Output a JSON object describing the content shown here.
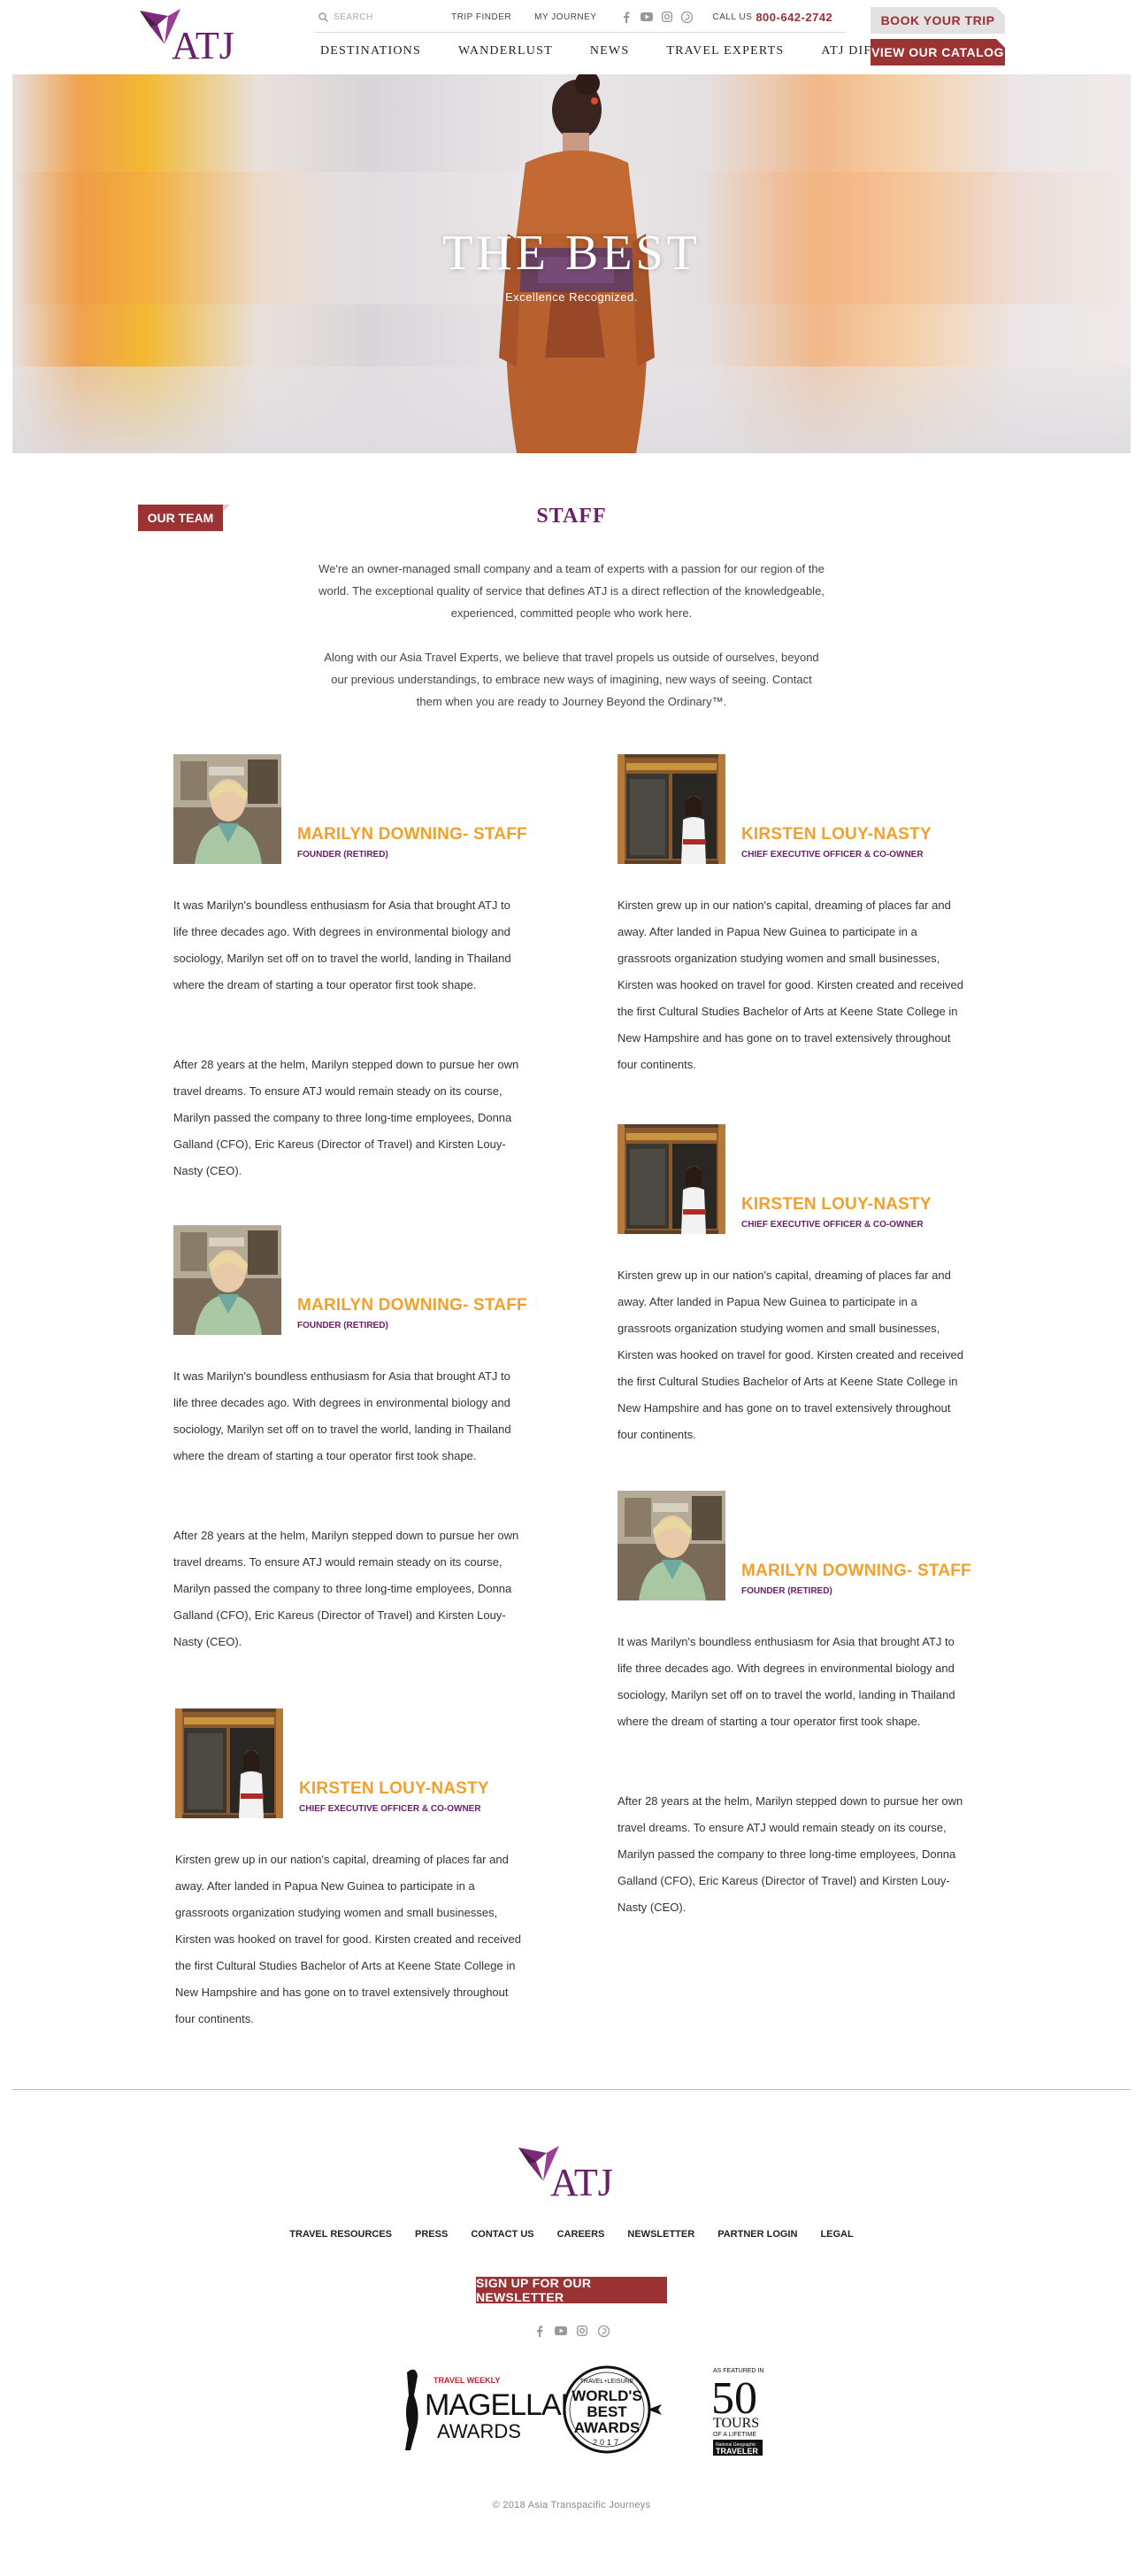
{
  "header": {
    "logo_text": "ATJ",
    "search_placeholder": "SEARCH",
    "util_links": [
      "TRIP FINDER",
      "MY JOURNEY"
    ],
    "social_icons": [
      "facebook-icon",
      "youtube-icon",
      "instagram-icon",
      "pinterest-icon"
    ],
    "call_label": "CALL US",
    "phone": "800-642-2742",
    "nav": [
      "DESTINATIONS",
      "WANDERLUST",
      "NEWS",
      "TRAVEL EXPERTS",
      "ATJ DIFFERENCE"
    ],
    "book_label": "BOOK YOUR TRIP",
    "catalog_label": "VIEW OUR CATALOG"
  },
  "hero": {
    "title": "THE BEST",
    "subtitle": "Excellence Recognized."
  },
  "intro": {
    "tag": "OUR TEAM",
    "title": "STAFF",
    "para1": "We're an owner-managed small company and a team of experts with a passion for our region of the world. The exceptional quality of service that defines ATJ is a direct reflection of the knowledgeable, experienced, committed people who work here.",
    "para2": "Along with our Asia Travel Experts, we believe that travel propels us outside of ourselves, beyond our previous understandings, to embrace new ways of imagining, new ways of seeing. Contact them when you are ready to Journey Beyond the Ordinary™."
  },
  "profiles": [
    {
      "name": "MARILYN DOWNING- STAFF",
      "role": "FOUNDER (RETIRED)",
      "photo": "marilyn",
      "bio1": "It was Marilyn's boundless enthusiasm for Asia that brought ATJ to life three decades ago. With degrees in environmental biology and sociology, Marilyn set off on to travel the world, landing in Thailand where the dream of starting a tour operator first took shape.",
      "bio2": "After 28 years at the helm, Marilyn stepped down to pursue her own travel dreams. To ensure ATJ would remain steady on its course, Marilyn passed the company to three long-time employees, Donna Galland (CFO), Eric Kareus (Director of Travel) and Kirsten Louy-Nasty (CEO)."
    },
    {
      "name": "KIRSTEN LOUY-NASTY",
      "role": "CHIEF EXECUTIVE OFFICER & CO-OWNER",
      "photo": "kirsten",
      "bio1": "Kirsten grew up in our nation's capital, dreaming of places far and away. After landed in Papua New Guinea to participate in a grassroots organization studying women and small businesses, Kirsten was hooked on travel for good. Kirsten created and received the first Cultural Studies Bachelor of Arts at Keene State College in New Hampshire and has gone on to travel extensively throughout four continents.",
      "bio2": ""
    },
    {
      "name": "KIRSTEN LOUY-NASTY",
      "role": "CHIEF EXECUTIVE OFFICER & CO-OWNER",
      "photo": "kirsten",
      "bio1": "Kirsten grew up in our nation's capital, dreaming of places far and away. After landed in Papua New Guinea to participate in a grassroots organization studying women and small businesses, Kirsten was hooked on travel for good. Kirsten created and received the first Cultural Studies Bachelor of Arts at Keene State College in New Hampshire and has gone on to travel extensively throughout four continents.",
      "bio2": ""
    },
    {
      "name": "MARILYN DOWNING- STAFF",
      "role": "FOUNDER (RETIRED)",
      "photo": "marilyn",
      "bio1": "It was Marilyn's boundless enthusiasm for Asia that brought ATJ to life three decades ago. With degrees in environmental biology and sociology, Marilyn set off on to travel the world, landing in Thailand where the dream of starting a tour operator first took shape.",
      "bio2": "After 28 years at the helm, Marilyn stepped down to pursue her own travel dreams. To ensure ATJ would remain steady on its course, Marilyn passed the company to three long-time employees, Donna Galland (CFO), Eric Kareus (Director of Travel) and Kirsten Louy-Nasty (CEO)."
    },
    {
      "name": "MARILYN DOWNING- STAFF",
      "role": "FOUNDER (RETIRED)",
      "photo": "marilyn",
      "bio1": "It was Marilyn's boundless enthusiasm for Asia that brought ATJ to life three decades ago. With degrees in environmental biology and sociology, Marilyn set off on to travel the world, landing in Thailand where the dream of starting a tour operator first took shape.",
      "bio2": "After 28 years at the helm, Marilyn stepped down to pursue her own travel dreams. To ensure ATJ would remain steady on its course, Marilyn passed the company to three long-time employees, Donna Galland (CFO), Eric Kareus (Director of Travel) and Kirsten Louy-Nasty (CEO)."
    },
    {
      "name": "KIRSTEN LOUY-NASTY",
      "role": "CHIEF EXECUTIVE OFFICER & CO-OWNER",
      "photo": "kirsten",
      "bio1": "Kirsten grew up in our nation's capital, dreaming of places far and away. After landed in Papua New Guinea to participate in a grassroots organization studying women and small businesses, Kirsten was hooked on travel for good. Kirsten created and received the first Cultural Studies Bachelor of Arts at Keene State College in New Hampshire and has gone on to travel extensively throughout four continents.",
      "bio2": ""
    }
  ],
  "footer": {
    "logo_text": "ATJ",
    "links": [
      "TRAVEL RESOURCES",
      "PRESS",
      "CONTACT US",
      "CAREERS",
      "NEWSLETTER",
      "PARTNER LOGIN",
      "LEGAL"
    ],
    "newsletter_label": "SIGN UP FOR OUR NEWSLETTER",
    "social_icons": [
      "facebook-icon",
      "youtube-icon",
      "instagram-icon",
      "pinterest-icon"
    ],
    "awards": {
      "magellan_top": "TRAVEL WEEKLY",
      "magellan_main": "MAGELLAN",
      "magellan_sub": "AWARDS",
      "wba_top": "TRAVEL+LEISURE",
      "wba_line1": "WORLD'S",
      "wba_line2": "BEST",
      "wba_line3": "AWARDS",
      "wba_year": "2017",
      "tours_top": "AS FEATURED IN",
      "tours_num": "50",
      "tours_line1": "TOURS",
      "tours_line2": "OF A LIFETIME",
      "tours_brand1": "National Geographic",
      "tours_brand2": "TRAVELER"
    },
    "copyright": "© 2018 Asia Transpacific Journeys"
  },
  "colors": {
    "brand_purple": "#6a2069",
    "brand_red": "#9b3233",
    "accent_orange": "#f2a02c"
  }
}
